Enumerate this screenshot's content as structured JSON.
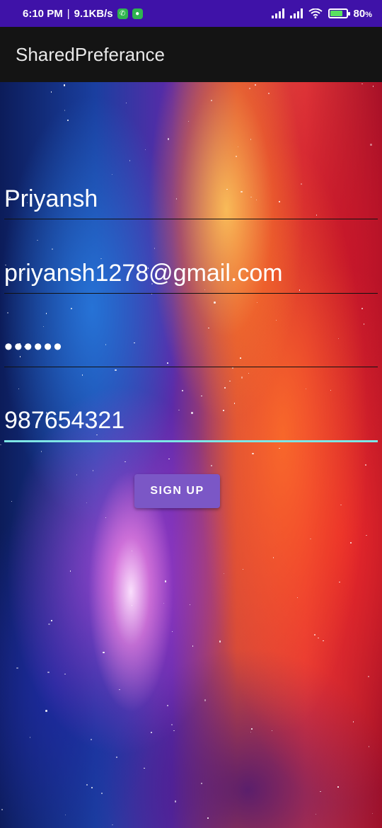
{
  "status_bar": {
    "time": "6:10 PM",
    "separator": "|",
    "speed": "9.1KB/s",
    "battery": "80",
    "battery_unit": "%",
    "battery_level": 0.8,
    "icons": [
      "call-icon",
      "whatsapp-icon",
      "signal-icon",
      "signal-icon",
      "wifi-icon",
      "battery-icon"
    ]
  },
  "app_bar": {
    "title": "SharedPreferance"
  },
  "form": {
    "name_value": "Priyansh",
    "email_value": "priyansh1278@gmail.com",
    "password_mask": "••••••",
    "phone_value": "987654321",
    "signup_label": "SIGN UP"
  },
  "colors": {
    "status_bar": "#3f12a8",
    "app_bar": "#141414",
    "button": "#7b57c6",
    "focus_underline": "#7ee6e6"
  }
}
